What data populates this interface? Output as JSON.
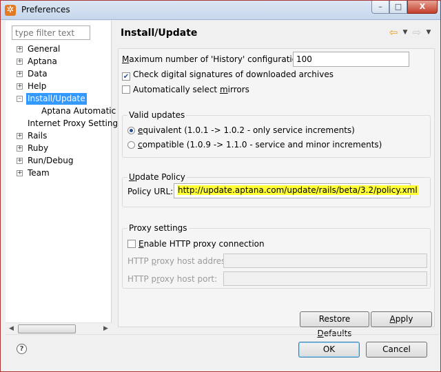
{
  "window": {
    "title": "Preferences",
    "app_icon": "gear-icon",
    "minimize_glyph": "–",
    "maximize_glyph": "□",
    "close_glyph": "X"
  },
  "filter": {
    "placeholder": "type filter text",
    "value": ""
  },
  "tree": {
    "items": [
      {
        "label": "General",
        "toggle": "+"
      },
      {
        "label": "Aptana",
        "toggle": "+"
      },
      {
        "label": "Data",
        "toggle": "+"
      },
      {
        "label": "Help",
        "toggle": "+"
      },
      {
        "label": "Install/Update",
        "toggle": "–",
        "selected": true
      },
      {
        "label": "Aptana Automatic",
        "toggle": ""
      },
      {
        "label": "Internet Proxy Settings",
        "toggle": ""
      },
      {
        "label": "Rails",
        "toggle": "+"
      },
      {
        "label": "Ruby",
        "toggle": "+"
      },
      {
        "label": "Run/Debug",
        "toggle": "+"
      },
      {
        "label": "Team",
        "toggle": "+"
      }
    ]
  },
  "page": {
    "title": "Install/Update",
    "history_label_pre": "",
    "history_label_u": "M",
    "history_label_post": "aximum number of 'History' configurations:",
    "history_value": "100",
    "check_signatures_label": "Check digital signatures of downloaded archives",
    "check_signatures_checked": true,
    "auto_mirrors_pre": "Automatically select ",
    "auto_mirrors_u": "m",
    "auto_mirrors_post": "irrors",
    "auto_mirrors_checked": false
  },
  "valid_updates": {
    "title": "Valid updates",
    "equivalent_u": "e",
    "equivalent_rest": "quivalent (1.0.1 -> 1.0.2 - only service increments)",
    "compatible_u": "c",
    "compatible_rest": "ompatible (1.0.9 -> 1.1.0 - service and minor increments)",
    "selected": "equivalent"
  },
  "update_policy": {
    "title_u": "U",
    "title_rest": "pdate Policy",
    "url_label": "Policy URL:",
    "url_value": "http://update.aptana.com/update/rails/beta/3.2/policy.xml",
    "highlight_color": "#ffff33"
  },
  "proxy": {
    "title": "Proxy settings",
    "enable_u": "E",
    "enable_rest": "nable HTTP proxy connection",
    "enable_checked": false,
    "host_label_pre": "HTTP ",
    "host_label_u": "p",
    "host_label_post": "roxy host address:",
    "port_label_pre": "HTTP p",
    "port_label_u": "r",
    "port_label_post": "oxy host port:"
  },
  "buttons": {
    "restore_pre": "Restore ",
    "restore_u": "D",
    "restore_post": "efaults",
    "apply_u": "A",
    "apply_post": "pply",
    "ok": "OK",
    "cancel": "Cancel",
    "help_glyph": "?"
  },
  "icons": {
    "back": "back-arrow-icon",
    "forward": "forward-arrow-icon",
    "dropdown": "chevron-down-icon",
    "help": "help-icon"
  }
}
